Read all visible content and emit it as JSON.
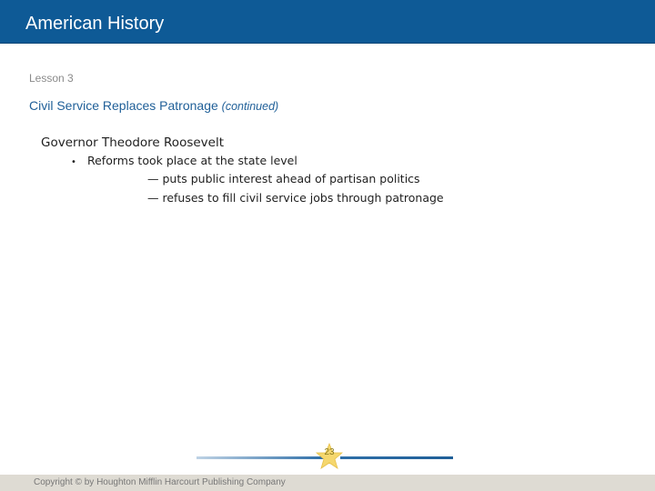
{
  "header": {
    "title": "American History"
  },
  "slide": {
    "lesson": "Lesson 3",
    "title": "Civil Service Replaces Patronage",
    "title_suffix": "(continued)",
    "heading": "Governor Theodore Roosevelt",
    "bullet": "Reforms took place at the state level",
    "subpoints": [
      "— puts public interest ahead of partisan politics",
      "— refuses to fill civil service jobs through patronage"
    ]
  },
  "footer": {
    "page_number": "23",
    "copyright": "Copyright © by Houghton Mifflin Harcourt Publishing Company"
  },
  "colors": {
    "header_bg": "#0e5a96",
    "title_blue": "#1f5f98",
    "star_gold": "#f5d76e"
  }
}
